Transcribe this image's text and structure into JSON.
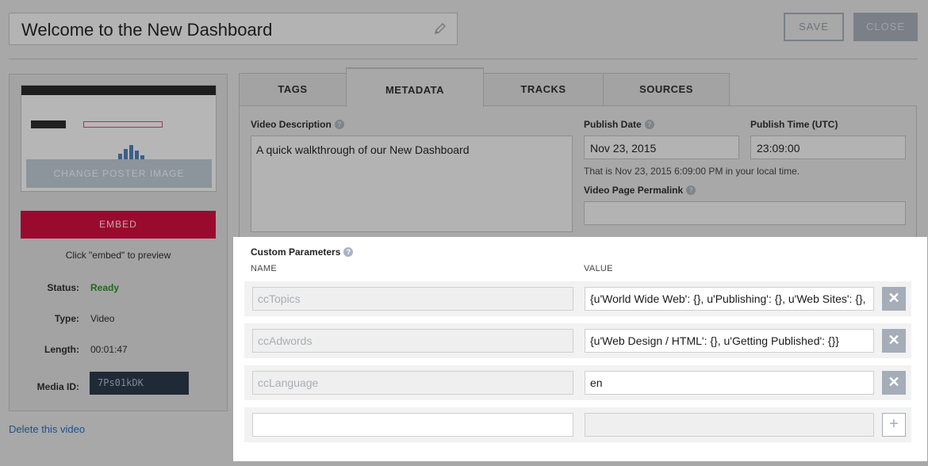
{
  "header": {
    "title": "Welcome to the New Dashboard",
    "save_label": "SAVE",
    "close_label": "CLOSE"
  },
  "left_panel": {
    "change_poster_label": "CHANGE POSTER IMAGE",
    "embed_label": "EMBED",
    "embed_hint": "Click \"embed\" to preview",
    "status_label": "Status:",
    "status_value": "Ready",
    "type_label": "Type:",
    "type_value": "Video",
    "length_label": "Length:",
    "length_value": "00:01:47",
    "media_id_label": "Media ID:",
    "media_id_value": "7Ps01kDK",
    "delete_label": "Delete this video"
  },
  "tabs": [
    {
      "label": "TAGS",
      "active": false
    },
    {
      "label": "METADATA",
      "active": true
    },
    {
      "label": "TRACKS",
      "active": false
    },
    {
      "label": "SOURCES",
      "active": false
    }
  ],
  "metadata": {
    "description_label": "Video Description",
    "description_value": "A quick walkthrough of our New Dashboard",
    "publish_date_label": "Publish Date",
    "publish_date_value": "Nov 23, 2015",
    "publish_time_label": "Publish Time (UTC)",
    "publish_time_value": "23:09:00",
    "local_time_note": "That is Nov 23, 2015 6:09:00 PM in your local time.",
    "permalink_label": "Video Page Permalink",
    "permalink_value": ""
  },
  "custom_params": {
    "label": "Custom Parameters",
    "name_header": "NAME",
    "value_header": "VALUE",
    "rows": [
      {
        "name": "ccTopics",
        "value": "{u'World Wide Web': {}, u'Publishing': {}, u'Web Sites': {},"
      },
      {
        "name": "ccAdwords",
        "value": "{u'Web Design / HTML': {}, u'Getting Published': {}}"
      },
      {
        "name": "ccLanguage",
        "value": "en"
      }
    ],
    "new_row": {
      "name": "",
      "value": ""
    },
    "remove_symbol": "✕",
    "add_symbol": "+"
  },
  "colors": {
    "embed": "#9a0a2e",
    "status_ready": "#1d6b1d",
    "action_button": "#a5adb9",
    "media_id_bg": "#1f2a36"
  }
}
